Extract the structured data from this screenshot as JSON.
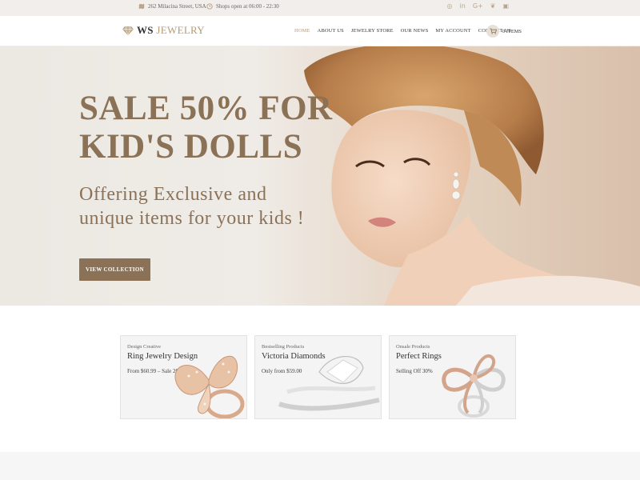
{
  "topbar": {
    "address": "262 Milacina Street, USA",
    "hours": "Shops open at 06:00 - 22:30",
    "social": [
      "instagram-icon",
      "linkedin-icon",
      "google-plus-icon",
      "twitter-icon",
      "youtube-icon"
    ]
  },
  "header": {
    "logo_ws": "WS",
    "logo_jewelry": "JEWELRY",
    "nav": [
      "HOME",
      "ABOUT US",
      "JEWELRY STORE",
      "OUR NEWS",
      "MY ACCOUNT",
      "CONTACT US"
    ],
    "cart_label": "0 ITEMS"
  },
  "hero": {
    "headline_line1": "SALE 50% FOR",
    "headline_line2": "KID'S DOLLS",
    "subline1": "Offering Exclusive and",
    "subline2": "unique items for your kids !",
    "button": "VIEW COLLECTION"
  },
  "cards": [
    {
      "sub": "Design Creative",
      "title": "Ring Jewelry Design",
      "desc": "From $60.99 – Sale 20%"
    },
    {
      "sub": "Bestselling Products",
      "title": "Victoria Diamonds",
      "desc": "Only from $59.00"
    },
    {
      "sub": "Onsale Products",
      "title": "Perfect Rings",
      "desc": "Selling Off 30%"
    }
  ],
  "colors": {
    "accent": "#8b7256",
    "gold": "#b49a78",
    "topbar_bg": "#f1eeec"
  }
}
